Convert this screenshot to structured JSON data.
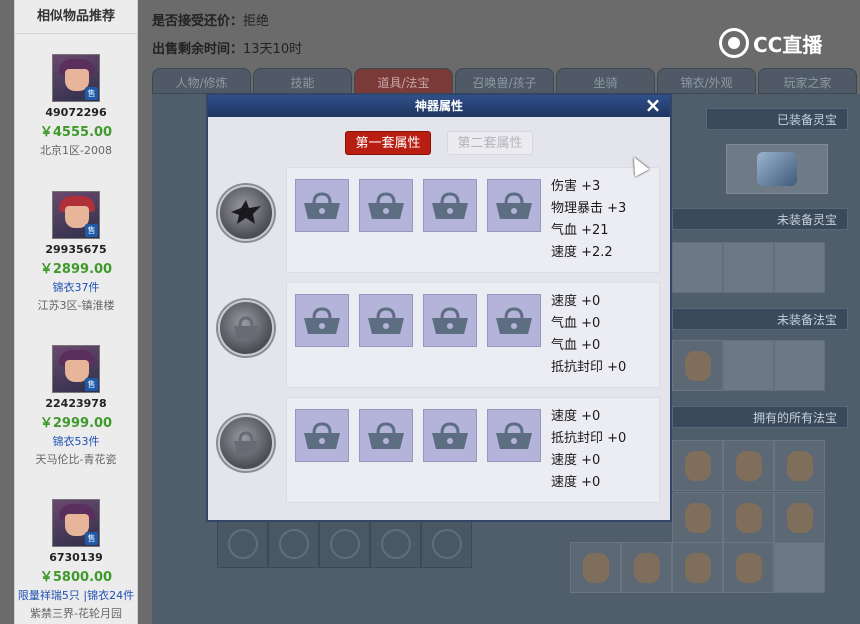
{
  "sidebar": {
    "title": "相似物品推荐",
    "items": [
      {
        "id": "49072296",
        "price": "￥4555.00",
        "sub": "",
        "server": "北京1区-2008",
        "tag": "售",
        "hair": "purple"
      },
      {
        "id": "29935675",
        "price": "￥2899.00",
        "sub": "锦衣37件",
        "server": "江苏3区-镇淮楼",
        "tag": "售",
        "hair": "red"
      },
      {
        "id": "22423978",
        "price": "￥2999.00",
        "sub": "锦衣53件",
        "server": "天马伦比-青花瓷",
        "tag": "售",
        "hair": "purple"
      },
      {
        "id": "6730139",
        "price": "￥5800.00",
        "sub": "限量祥瑞5只 |锦衣24件",
        "server": "紫禁三界-花轮月园",
        "tag": "售",
        "hair": "purple"
      }
    ]
  },
  "info": {
    "bargain_label": "是否接受还价：",
    "bargain_value": "拒绝",
    "time_label": "出售剩余时间：",
    "time_value": "13天10时"
  },
  "logo": {
    "text": "CC直播"
  },
  "tabs": [
    "人物/修炼",
    "技能",
    "道具/法宝",
    "召唤兽/孩子",
    "坐骑",
    "锦衣/外观",
    "玩家之家"
  ],
  "active_tab_index": 2,
  "background_labels": {
    "equipped_spirit": "已装备灵宝",
    "unequipped_spirit": "未装备灵宝",
    "unequipped_fabao": "未装备法宝",
    "all_fabao": "拥有的所有法宝"
  },
  "modal": {
    "title": "神器属性",
    "close_label": "×",
    "tab_first": "第一套属性",
    "tab_second": "第二套属性",
    "sets": [
      {
        "icon": "bird-gem-icon",
        "stats": [
          "伤害 +3",
          "物理暴击 +3",
          "气血 +21",
          "速度 +2.2"
        ]
      },
      {
        "icon": "lock-gem-icon",
        "stats": [
          "速度 +0",
          "气血 +0",
          "气血 +0",
          "抵抗封印 +0"
        ]
      },
      {
        "icon": "lock-gem-icon",
        "stats": [
          "速度 +0",
          "抵抗封印 +0",
          "速度 +0",
          "速度 +0"
        ]
      }
    ]
  },
  "colors": {
    "active_tab": "#b81e12",
    "price_green": "#3e9a2a",
    "link_blue": "#1e50b4",
    "modal_header": "#1e3560",
    "slot_lavender": "#b4b4da"
  }
}
